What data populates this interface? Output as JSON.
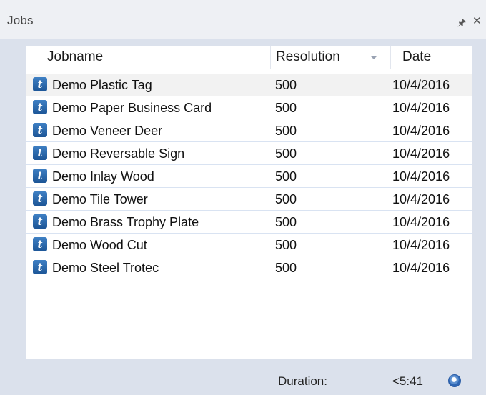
{
  "window": {
    "title": "Jobs",
    "pin_icon": "pin-icon",
    "close_icon": "close-icon"
  },
  "table": {
    "columns": {
      "jobname": "Jobname",
      "resolution": "Resolution",
      "date": "Date"
    },
    "sort_column": "resolution",
    "rows": [
      {
        "name": "Demo Plastic Tag",
        "resolution": "500",
        "date": "10/4/2016",
        "selected": true
      },
      {
        "name": "Demo Paper Business Card",
        "resolution": "500",
        "date": "10/4/2016"
      },
      {
        "name": "Demo Veneer Deer",
        "resolution": "500",
        "date": "10/4/2016"
      },
      {
        "name": "Demo Reversable Sign",
        "resolution": "500",
        "date": "10/4/2016"
      },
      {
        "name": "Demo Inlay Wood",
        "resolution": "500",
        "date": "10/4/2016"
      },
      {
        "name": "Demo Tile Tower",
        "resolution": "500",
        "date": "10/4/2016"
      },
      {
        "name": "Demo Brass Trophy Plate",
        "resolution": "500",
        "date": "10/4/2016"
      },
      {
        "name": "Demo Wood Cut",
        "resolution": "500",
        "date": "10/4/2016"
      },
      {
        "name": "Demo Steel Trotec",
        "resolution": "500",
        "date": "10/4/2016"
      }
    ]
  },
  "footer": {
    "duration_label": "Duration:",
    "duration_value": "<5:41",
    "status_icon": "status-icon"
  }
}
